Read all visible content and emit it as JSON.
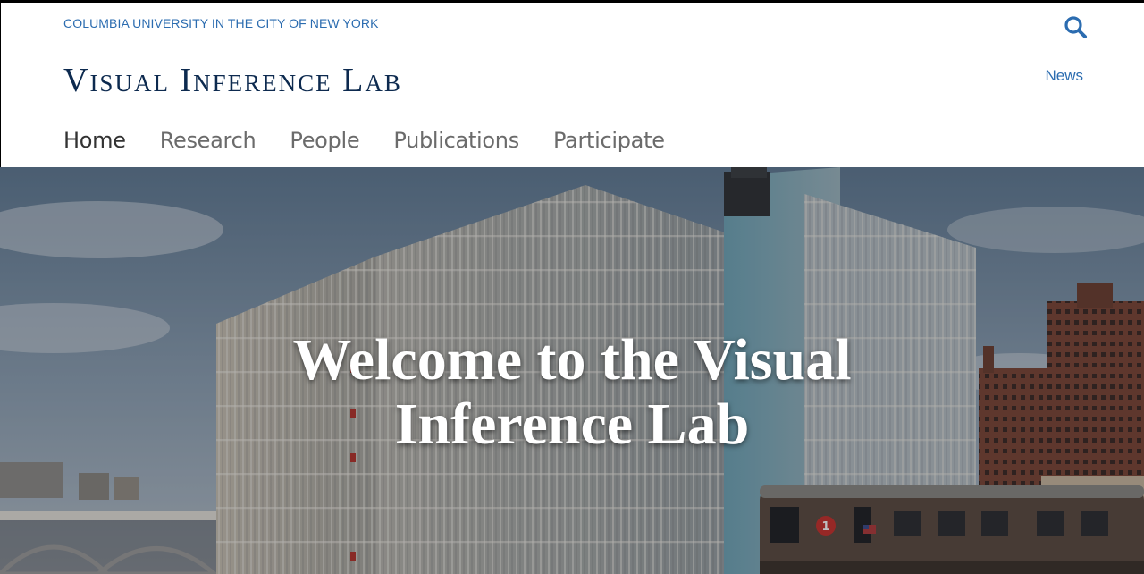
{
  "header": {
    "university": "COLUMBIA UNIVERSITY IN THE CITY OF NEW YORK",
    "lab_title": "Visual Inference Lab",
    "news_label": "News",
    "search_icon": "search-icon"
  },
  "nav": {
    "items": [
      {
        "label": "Home",
        "active": true
      },
      {
        "label": "Research",
        "active": false
      },
      {
        "label": "People",
        "active": false
      },
      {
        "label": "Publications",
        "active": false
      },
      {
        "label": "Participate",
        "active": false
      }
    ]
  },
  "hero": {
    "title_line1": "Welcome to the Visual",
    "title_line2": "Inference Lab",
    "train_route": "1"
  },
  "colors": {
    "accent_blue": "#2b6cb0",
    "title_navy": "#0d2a4f"
  }
}
